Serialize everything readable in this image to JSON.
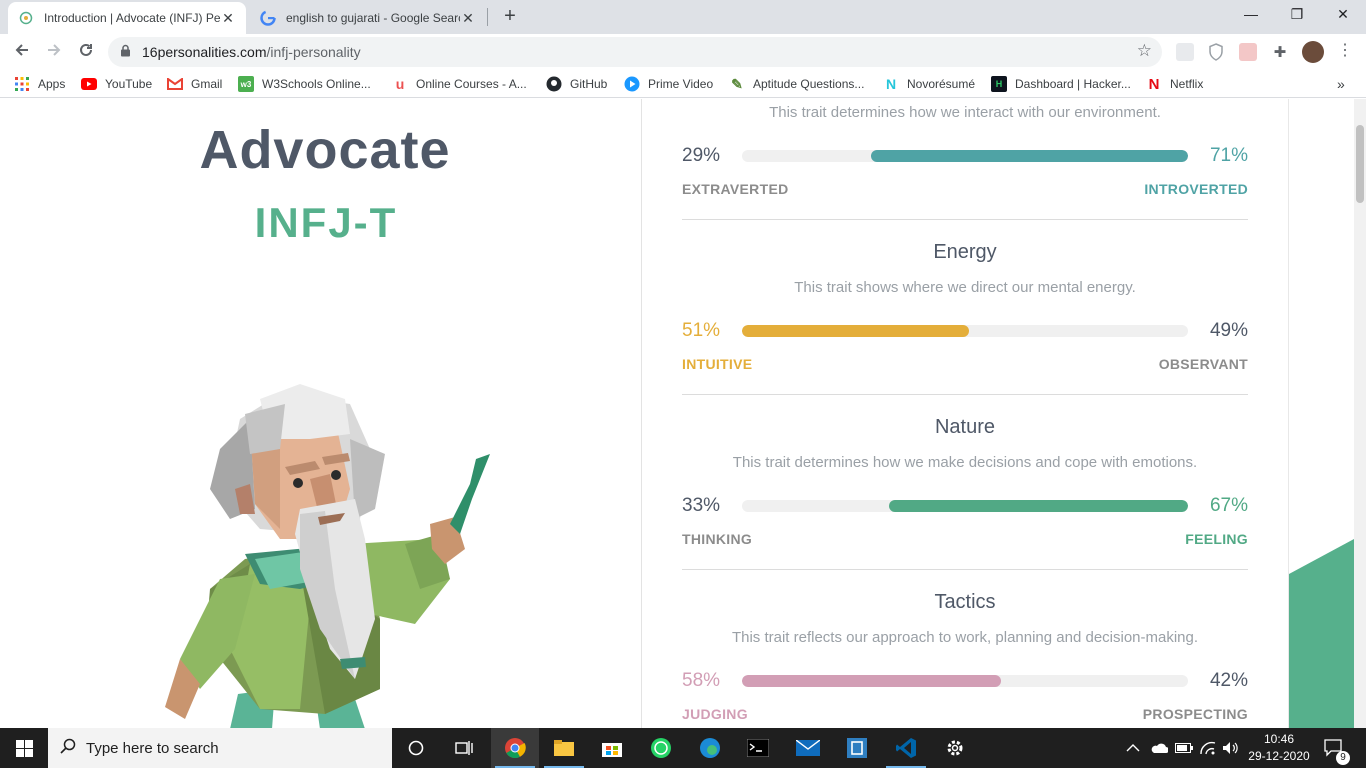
{
  "browser": {
    "tabs": [
      {
        "title": "Introduction | Advocate (INFJ) Pe",
        "active": true
      },
      {
        "title": "english to gujarati - Google Searc",
        "active": false
      }
    ],
    "new_tab": "+",
    "window_controls": {
      "minimize": "—",
      "restore": "❐",
      "close": "✕"
    },
    "url_domain": "16personalities.com",
    "url_path": "/infj-personality"
  },
  "bookmarks": [
    {
      "label": "Apps",
      "icon": "apps-grid-icon"
    },
    {
      "label": "YouTube",
      "icon": "youtube-icon"
    },
    {
      "label": "Gmail",
      "icon": "gmail-icon"
    },
    {
      "label": "W3Schools Online...",
      "icon": "w3schools-icon"
    },
    {
      "label": "Online Courses - A...",
      "icon": "udemy-icon"
    },
    {
      "label": "GitHub",
      "icon": "github-icon"
    },
    {
      "label": "Prime Video",
      "icon": "prime-video-icon"
    },
    {
      "label": "Aptitude Questions...",
      "icon": "aptitude-icon"
    },
    {
      "label": "Novorésumé",
      "icon": "novoresume-icon"
    },
    {
      "label": "Dashboard | Hacker...",
      "icon": "hackerrank-icon"
    },
    {
      "label": "Netflix",
      "icon": "netflix-icon"
    }
  ],
  "bookmarks_more": "»",
  "profile": {
    "name": "Advocate",
    "code": "INFJ-T"
  },
  "traits": [
    {
      "title": "",
      "description": "This trait determines how we interact with our environment.",
      "left_pct": "29%",
      "right_pct": "71%",
      "left_label": "EXTRAVERTED",
      "right_label": "INTROVERTED",
      "dominant": "right",
      "value": 0.71,
      "color": "#4fa3a5"
    },
    {
      "title": "Energy",
      "description": "This trait shows where we direct our mental energy.",
      "left_pct": "51%",
      "right_pct": "49%",
      "left_label": "INTUITIVE",
      "right_label": "OBSERVANT",
      "dominant": "left",
      "value": 0.51,
      "color": "#e4ae3a"
    },
    {
      "title": "Nature",
      "description": "This trait determines how we make decisions and cope with emotions.",
      "left_pct": "33%",
      "right_pct": "67%",
      "left_label": "THINKING",
      "right_label": "FEELING",
      "dominant": "right",
      "value": 0.67,
      "color": "#51a985"
    },
    {
      "title": "Tactics",
      "description": "This trait reflects our approach to work, planning and decision-making.",
      "left_pct": "58%",
      "right_pct": "42%",
      "left_label": "JUDGING",
      "right_label": "PROSPECTING",
      "dominant": "left",
      "value": 0.58,
      "color": "#d29eb5"
    }
  ],
  "taskbar": {
    "search_placeholder": "Type here to search",
    "apps": [
      "cortana-icon",
      "task-view-icon",
      "chrome-icon",
      "file-explorer-icon",
      "store-icon",
      "whatsapp-icon",
      "edge-icon",
      "terminal-icon",
      "mail-icon",
      "app-icon",
      "vscode-icon",
      "settings-icon"
    ],
    "time": "10:46",
    "date": "29-12-2020",
    "notifications": "9"
  }
}
